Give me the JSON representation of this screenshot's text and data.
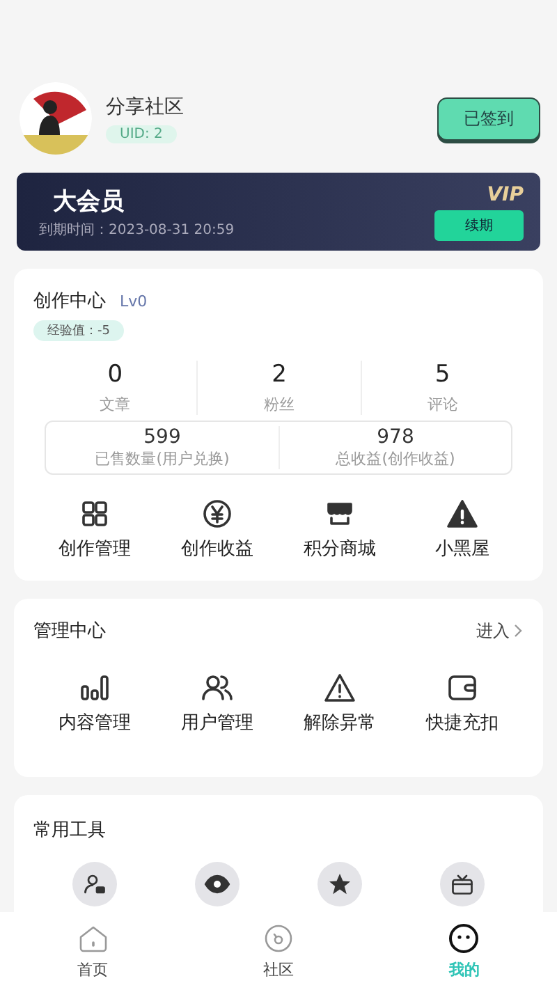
{
  "profile": {
    "name": "分享社区",
    "uid": "UID: 2",
    "checkin_button": "已签到"
  },
  "vip": {
    "title": "大会员",
    "expiry": "到期时间：2023-08-31 20:59",
    "badge": "VIP",
    "renew_button": "续期"
  },
  "creation": {
    "title": "创作中心",
    "level": "Lv0",
    "exp": "经验值：-5",
    "stats": [
      {
        "value": "0",
        "label": "文章"
      },
      {
        "value": "2",
        "label": "粉丝"
      },
      {
        "value": "5",
        "label": "评论"
      }
    ],
    "earnings": [
      {
        "value": "599",
        "label": "已售数量(用户兑换)"
      },
      {
        "value": "978",
        "label": "总收益(创作收益)"
      }
    ],
    "actions": [
      {
        "label": "创作管理"
      },
      {
        "label": "创作收益"
      },
      {
        "label": "积分商城"
      },
      {
        "label": "小黑屋"
      }
    ]
  },
  "management": {
    "title": "管理中心",
    "enter_link": "进入",
    "actions": [
      {
        "label": "内容管理"
      },
      {
        "label": "用户管理"
      },
      {
        "label": "解除异常"
      },
      {
        "label": "快捷充扣"
      }
    ]
  },
  "tools": {
    "title": "常用工具"
  },
  "nav": [
    {
      "label": "首页",
      "selected": false
    },
    {
      "label": "社区",
      "selected": false
    },
    {
      "label": "我的",
      "selected": true
    }
  ]
}
